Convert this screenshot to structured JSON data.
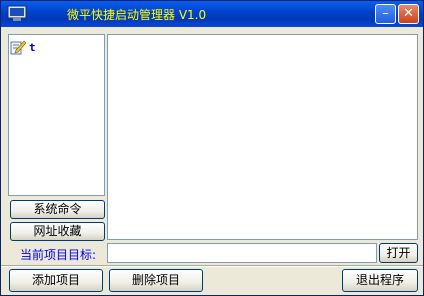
{
  "window": {
    "title": "微平快捷启动管理器 V1.0",
    "minimize_glyph": "–",
    "close_glyph": "✕",
    "app_icon": "monitor-icon"
  },
  "tree": {
    "items": [
      {
        "label": "t",
        "icon": "document-pencil-icon"
      }
    ]
  },
  "left_buttons": {
    "system_commands": "系统命令",
    "url_favorites": "网址收藏"
  },
  "target": {
    "label": "当前项目目标:",
    "value": "",
    "open_button": "打开"
  },
  "bottom": {
    "add": "添加项目",
    "delete": "删除项目",
    "exit": "退出程序"
  },
  "colors": {
    "title_text": "#ffff00",
    "target_label": "#0000ff",
    "titlebar": "#0041c8",
    "window_bg": "#ece9d8"
  }
}
